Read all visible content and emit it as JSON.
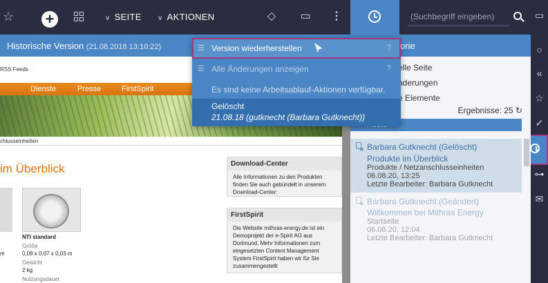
{
  "toolbar": {
    "seite_label": "SEITE",
    "aktionen_label": "AKTIONEN",
    "search_placeholder": "(Suchbegriff eingeben)"
  },
  "preview": {
    "title": "Historische Version",
    "date": "(21.08.2018 13:10:22)",
    "rss": "RSS Feeds",
    "nav": [
      "Dienste",
      "Presse",
      "FirstSpirit"
    ],
    "breadcrumb": "chlusseinheiten",
    "heading": "im Überblick",
    "product_name": "NTI standard",
    "spec_size_label": "Größe",
    "spec_size_value": "0,09 x 0,07 x 0,03 m",
    "spec_weight_label": "Gewicht",
    "spec_weight_value": "2 kg",
    "spec_usage_label": "Nutzungsdauer",
    "spec_unit": "m",
    "download_title": "Download-Center",
    "download_text": "Alle Informationen zu den Produkten finden Sie auch gebündelt in unserem Download-Center:",
    "fs_title": "FirstSpirit",
    "fs_text": "Die Website mithras-energy.de ist ein Demoprojekt der e-Spirit AG aus Dortmund. Mehr Informationen zum eingesetzten Content Management System FirstSpirit haben wir für Sie zusammengestellt"
  },
  "history": {
    "header": "orie",
    "option1": "elle Seite",
    "option2": "nderungen",
    "option3": "e Elemente",
    "results": "Ergebnisse: 25",
    "today": "Heute",
    "entries": [
      {
        "name": "Barbara Gutknecht (Gelöscht)",
        "title": "Produkte im Überblick",
        "path": "Produkte / Netzanschlusseinheiten",
        "date": "06.08.20, 13:25",
        "editor": "Letzte Bearbeiter: Barbara Gutknecht"
      },
      {
        "name": "Barbara Gutknecht (Geändert)",
        "title": "Willkommen bei Mithras Energy",
        "path": "Startseite",
        "date": "06.08.20, 12:04",
        "editor": "Letzte Bearbeiter: Barbara Gutknecht"
      }
    ]
  },
  "dropdown": {
    "items": [
      {
        "label": "Version wiederherstellen",
        "help": "?"
      },
      {
        "label": "Alle Änderungen anzeigen",
        "help": "?"
      }
    ],
    "note": "Es sind keine Arbeitsablauf-Aktionen verfügbar.",
    "deleted_title": "Gelöscht",
    "deleted_detail": "21.08.18 (gutknecht (Barbara Gutknecht))"
  },
  "colors": {
    "accent": "#4a86c5",
    "topbar": "#2a2d40",
    "highlight": "#a13a7c",
    "orange": "#d97510"
  }
}
